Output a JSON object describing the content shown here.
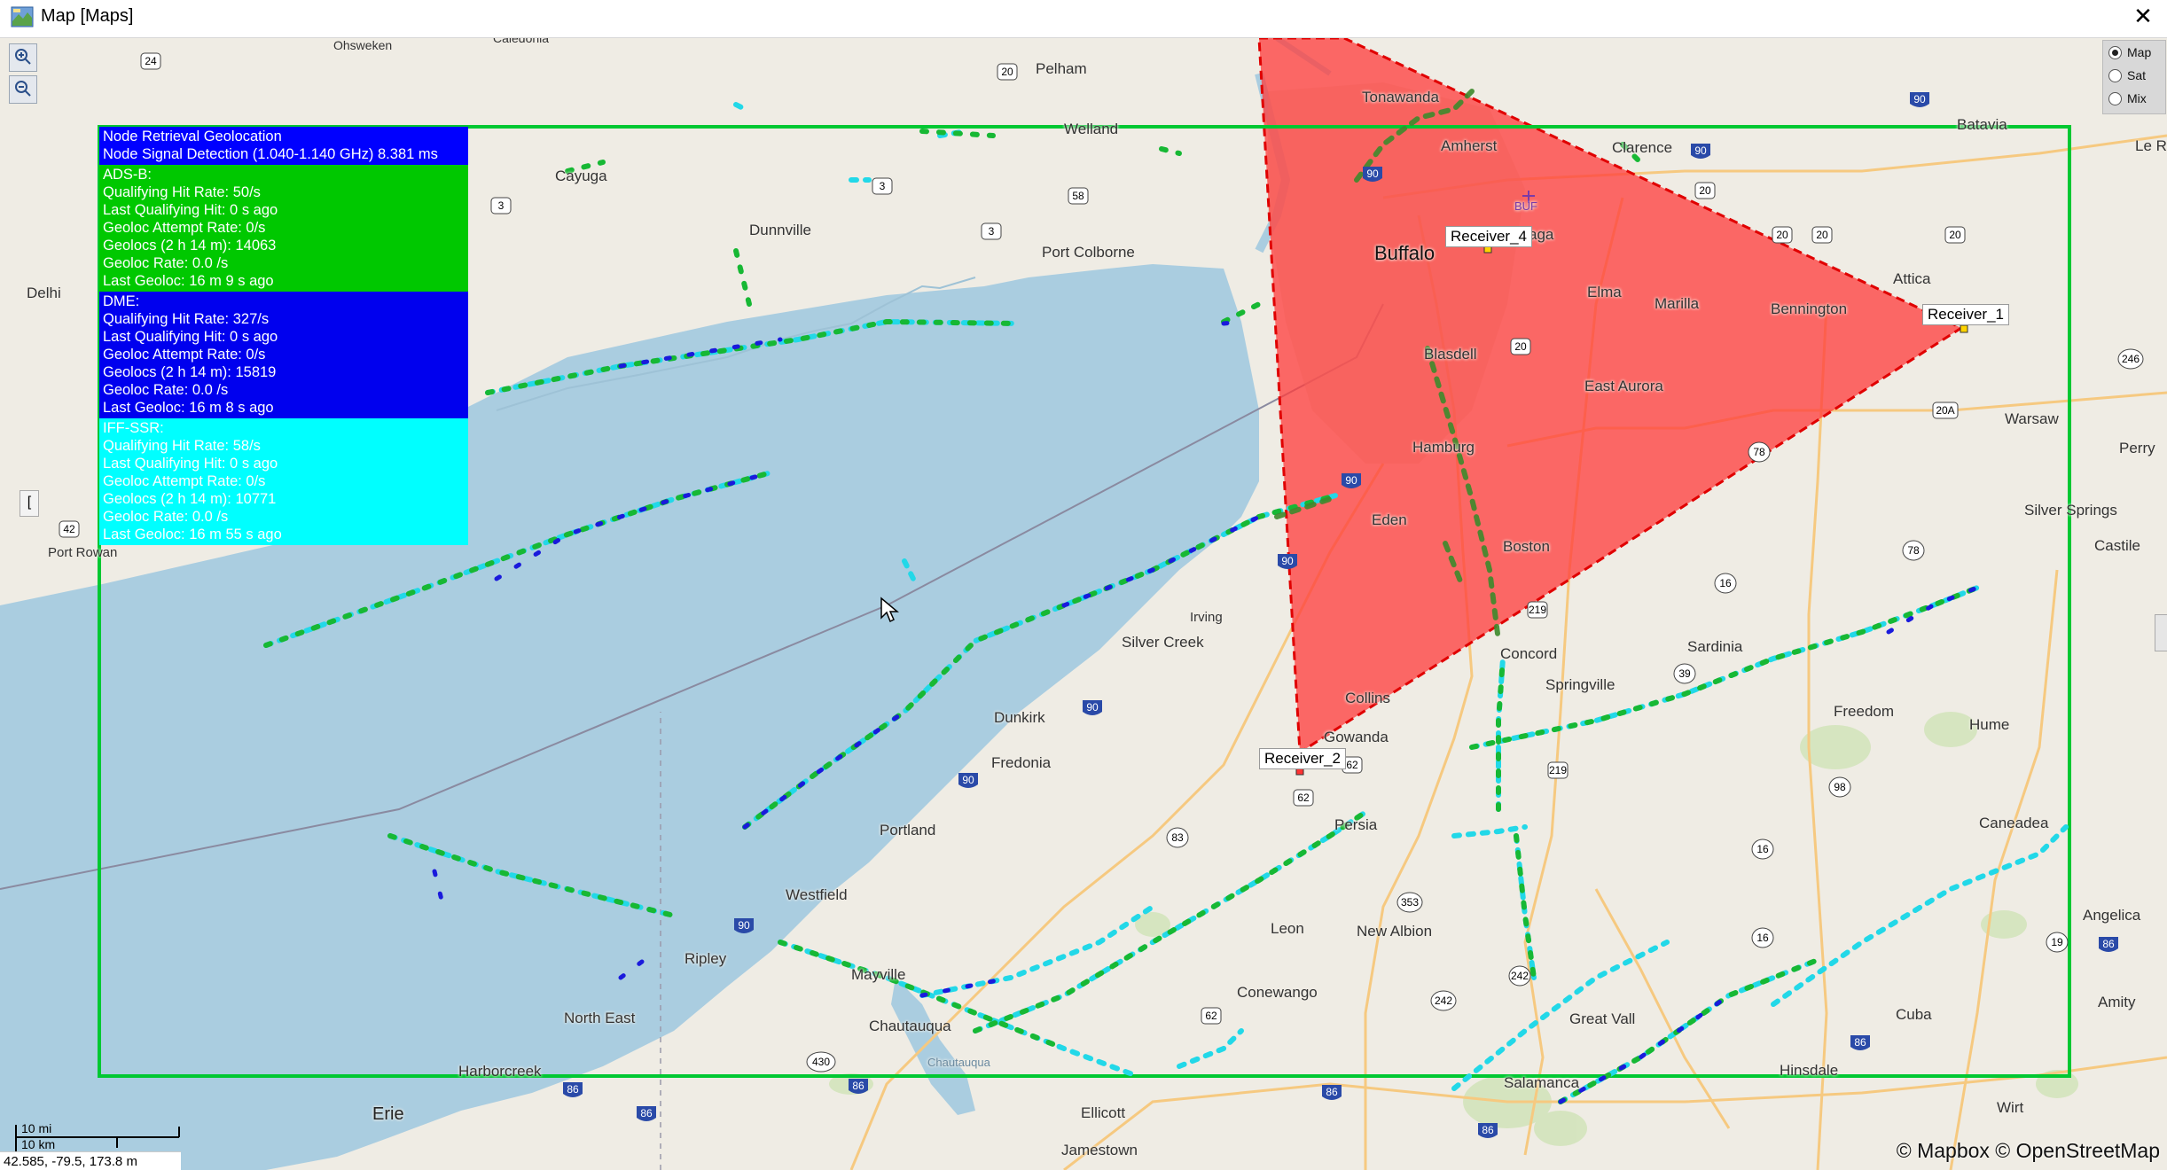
{
  "window": {
    "title": "Map [Maps]",
    "close_label": "✕"
  },
  "zoom": {
    "in_label": "+",
    "out_label": "−"
  },
  "map_type": {
    "options": [
      "Map",
      "Sat",
      "Mix"
    ],
    "selected": "Map"
  },
  "info_panel": {
    "header": {
      "line1": "Node Retrieval Geolocation",
      "line2": "Node Signal Detection (1.040-1.140 GHz) 8.381 ms",
      "color": "#0000ff"
    },
    "adsb": {
      "title": "ADS-B:",
      "qualifying_hit_rate": "Qualifying Hit Rate: 50/s",
      "last_qualifying_hit": "Last Qualifying Hit: 0 s ago",
      "geoloc_attempt_rate": "Geoloc Attempt Rate: 0/s",
      "geolocs": "Geolocs (2 h 14 m): 14063",
      "geoloc_rate": "Geoloc Rate: 0.0 /s",
      "last_geoloc": "Last Geoloc: 16 m 9 s ago",
      "color": "#00c800"
    },
    "dme": {
      "title": "DME:",
      "qualifying_hit_rate": "Qualifying Hit Rate: 327/s",
      "last_qualifying_hit": "Last Qualifying Hit: 0 s ago",
      "geoloc_attempt_rate": "Geoloc Attempt Rate: 0/s",
      "geolocs": "Geolocs (2 h 14 m): 15819",
      "geoloc_rate": "Geoloc Rate: 0.0 /s",
      "last_geoloc": "Last Geoloc: 16 m 8 s ago",
      "color": "#0000ee"
    },
    "iffssr": {
      "title": "IFF-SSR:",
      "qualifying_hit_rate": "Qualifying Hit Rate: 58/s",
      "last_qualifying_hit": "Last Qualifying Hit: 0 s ago",
      "geoloc_attempt_rate": "Geoloc Attempt Rate: 0/s",
      "geolocs": "Geolocs (2 h 14 m): 10771",
      "geoloc_rate": "Geoloc Rate: 0.0 /s",
      "last_geoloc": "Last Geoloc: 16 m 55 s ago",
      "color": "#00ffff"
    }
  },
  "receivers": {
    "r1": "Receiver_1",
    "r2": "Receiver_2",
    "r4": "Receiver_4"
  },
  "places": {
    "tonawanda": "Tonawanda",
    "amherst": "Amherst",
    "clarence": "Clarence",
    "batavia": "Batavia",
    "le_roy": "Le Ro",
    "buffalo": "Buffalo",
    "buf": "BUF",
    "lancaster": "aga",
    "attica": "Attica",
    "elma": "Elma",
    "marilla": "Marilla",
    "bennington": "Bennington",
    "blasdell": "Blasdell",
    "east_aurora": "East Aurora",
    "warsaw": "Warsaw",
    "perry": "Perry",
    "hamburg": "Hamburg",
    "eden": "Eden",
    "boston": "Boston",
    "silver_springs": "Silver Springs",
    "castile": "Castile",
    "irving": "Irving",
    "silver_creek": "Silver Creek",
    "concord": "Concord",
    "sardinia": "Sardinia",
    "springville": "Springville",
    "collins": "Collins",
    "gowanda": "Gowanda",
    "freedom": "Freedom",
    "hume": "Hume",
    "dunkirk": "Dunkirk",
    "fredonia": "Fredonia",
    "persia": "Persia",
    "portland": "Portland",
    "caneadea": "Caneadea",
    "westfield": "Westfield",
    "leon": "Leon",
    "new_albion": "New Albion",
    "angelica": "Angelica",
    "ripley": "Ripley",
    "mayville": "Mayville",
    "conewango": "Conewango",
    "amity": "Amity",
    "north_east": "North East",
    "chautauqua": "Chautauqua",
    "great_valley": "Great Vall",
    "cuba": "Cuba",
    "harborcreek": "Harborcreek",
    "salamanca": "Salamanca",
    "hinsdale": "Hinsdale",
    "erie": "Erie",
    "ellicott": "Ellicott",
    "wirt": "Wirt",
    "jamestown": "Jamestown",
    "delhi": "Delhi",
    "cayuga": "Cayuga",
    "dunnville": "Dunnville",
    "port_colborne": "Port Colborne",
    "welland": "Welland",
    "pelham": "Pelham",
    "ohsweken": "Ohsweken",
    "caledonia": "Caledonia",
    "port_rowan": "Port Rowan",
    "chautauqua_lake": "Chautauqua"
  },
  "shields": [
    "24",
    "20",
    "3",
    "3",
    "3",
    "58",
    "90",
    "20",
    "20",
    "20",
    "20",
    "20",
    "246",
    "20A",
    "78",
    "78",
    "16",
    "39",
    "90",
    "62",
    "219",
    "98",
    "83",
    "16",
    "353",
    "62",
    "242",
    "90",
    "430",
    "86",
    "86",
    "86",
    "86",
    "19",
    "16",
    "86",
    "62",
    "42",
    "3",
    "90",
    "90",
    "20",
    "16",
    "219"
  ],
  "scale": {
    "mi": "10 mi",
    "km": "10 km"
  },
  "status": {
    "coords": "42.585, -79.5, 173.8 m"
  },
  "attribution": "© Mapbox © OpenStreetMap",
  "colors": {
    "water": "#aacde0",
    "land": "#efece4",
    "bbox_green": "#00c832",
    "triangle_fill": "#ff3b3b",
    "triangle_edge": "#e00000"
  }
}
